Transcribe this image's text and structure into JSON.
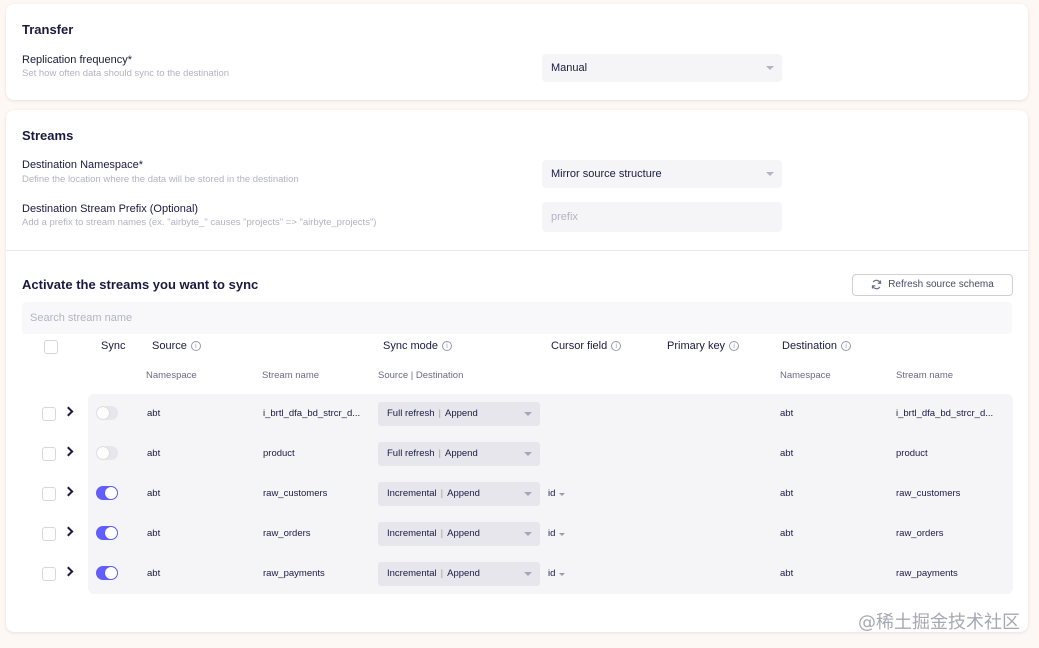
{
  "transfer": {
    "title": "Transfer",
    "replication_label": "Replication frequency*",
    "replication_hint": "Set how often data should sync to the destination",
    "replication_value": "Manual"
  },
  "streams": {
    "title": "Streams",
    "namespace_label": "Destination Namespace*",
    "namespace_hint": "Define the location where the data will be stored in the destination",
    "namespace_value": "Mirror source structure",
    "prefix_label": "Destination Stream Prefix (Optional)",
    "prefix_hint": "Add a prefix to stream names (ex. \"airbyte_\" causes \"projects\" => \"airbyte_projects\")",
    "prefix_placeholder": "prefix"
  },
  "activate": {
    "title": "Activate the streams you want to sync",
    "refresh_label": "Refresh source schema",
    "search_placeholder": "Search stream name"
  },
  "table": {
    "headers": {
      "sync": "Sync",
      "source": "Source",
      "sync_mode": "Sync mode",
      "cursor_field": "Cursor field",
      "primary_key": "Primary key",
      "destination": "Destination"
    },
    "subheaders": {
      "namespace": "Namespace",
      "stream_name": "Stream name",
      "source_destination": "Source | Destination",
      "dest_namespace": "Namespace",
      "dest_stream_name": "Stream name"
    },
    "rows": [
      {
        "enabled": false,
        "namespace": "abt",
        "stream": "i_brtl_dfa_bd_strcr_d...",
        "mode_source": "Full refresh",
        "mode_dest": "Append",
        "cursor": "",
        "dest_namespace": "abt",
        "dest_stream": "i_brtl_dfa_bd_strcr_d..."
      },
      {
        "enabled": false,
        "namespace": "abt",
        "stream": "product",
        "mode_source": "Full refresh",
        "mode_dest": "Append",
        "cursor": "",
        "dest_namespace": "abt",
        "dest_stream": "product"
      },
      {
        "enabled": true,
        "namespace": "abt",
        "stream": "raw_customers",
        "mode_source": "Incremental",
        "mode_dest": "Append",
        "cursor": "id",
        "dest_namespace": "abt",
        "dest_stream": "raw_customers"
      },
      {
        "enabled": true,
        "namespace": "abt",
        "stream": "raw_orders",
        "mode_source": "Incremental",
        "mode_dest": "Append",
        "cursor": "id",
        "dest_namespace": "abt",
        "dest_stream": "raw_orders"
      },
      {
        "enabled": true,
        "namespace": "abt",
        "stream": "raw_payments",
        "mode_source": "Incremental",
        "mode_dest": "Append",
        "cursor": "id",
        "dest_namespace": "abt",
        "dest_stream": "raw_payments"
      }
    ]
  },
  "info_glyph": "i",
  "watermark": "@稀土掘金技术社区",
  "colors": {
    "accent": "#615eff",
    "page_bg": "#fdf8f3",
    "text": "#1a1a40",
    "muted": "#b3b3c3"
  }
}
